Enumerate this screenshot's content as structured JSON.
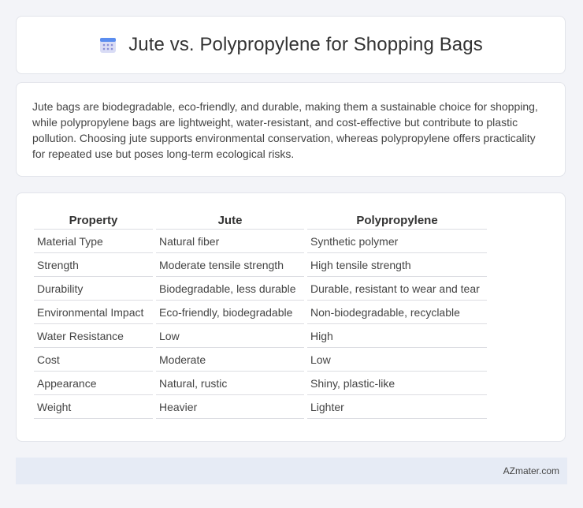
{
  "header": {
    "title": "Jute vs. Polypropylene for Shopping Bags",
    "icon": "calendar-grid-icon"
  },
  "summary": {
    "text": "Jute bags are biodegradable, eco-friendly, and durable, making them a sustainable choice for shopping, while polypropylene bags are lightweight, water-resistant, and cost-effective but contribute to plastic pollution. Choosing jute supports environmental conservation, whereas polypropylene offers practicality for repeated use but poses long-term ecological risks."
  },
  "table": {
    "headers": [
      "Property",
      "Jute",
      "Polypropylene"
    ],
    "rows": [
      [
        "Material Type",
        "Natural fiber",
        "Synthetic polymer"
      ],
      [
        "Strength",
        "Moderate tensile strength",
        "High tensile strength"
      ],
      [
        "Durability",
        "Biodegradable, less durable",
        "Durable, resistant to wear and tear"
      ],
      [
        "Environmental Impact",
        "Eco-friendly, biodegradable",
        "Non-biodegradable, recyclable"
      ],
      [
        "Water Resistance",
        "Low",
        "High"
      ],
      [
        "Cost",
        "Moderate",
        "Low"
      ],
      [
        "Appearance",
        "Natural, rustic",
        "Shiny, plastic-like"
      ],
      [
        "Weight",
        "Heavier",
        "Lighter"
      ]
    ]
  },
  "footer": {
    "brand": "AZmater.com"
  }
}
